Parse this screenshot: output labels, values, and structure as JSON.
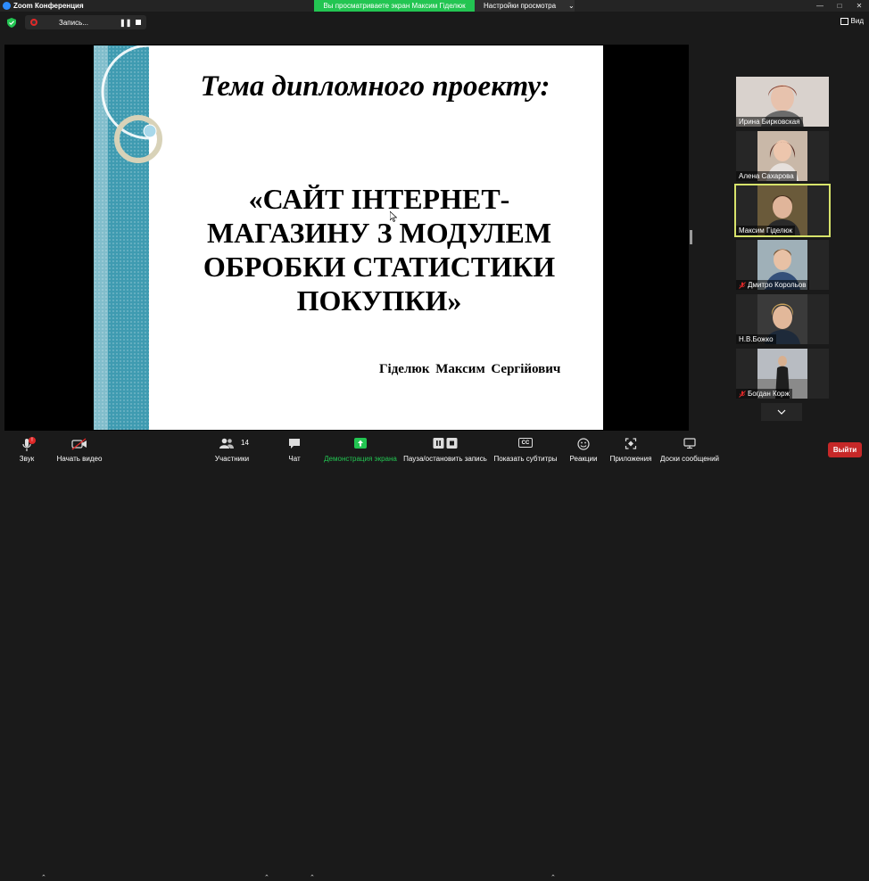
{
  "window": {
    "app_title": "Zoom Конференция",
    "viewing_banner": "Вы просматриваете экран Максим Гіделюк",
    "view_settings": "Настройки просмотра"
  },
  "recording": {
    "label": "Запись..."
  },
  "view_button": "Вид",
  "slide": {
    "title": "Тема дипломного проекту:",
    "topic_lines": [
      "«САЙТ ІНТЕРНЕТ-",
      "МАГАЗИНУ З МОДУЛЕМ",
      "ОБРОБКИ СТАТИСТИКИ",
      "ПОКУПКИ»"
    ],
    "author": "Гіделюк  Максим Сергійович"
  },
  "participants": [
    {
      "name": "Ирина Бирковская",
      "muted": false,
      "active": false
    },
    {
      "name": "Алена Сахарова",
      "muted": false,
      "active": false
    },
    {
      "name": "Максим Гіделюк",
      "muted": false,
      "active": true
    },
    {
      "name": "Дмитро Корольов",
      "muted": true,
      "active": false
    },
    {
      "name": "Н.В.Божко",
      "muted": false,
      "active": false
    },
    {
      "name": "Богдан Корж",
      "muted": true,
      "active": false
    }
  ],
  "toolbar": {
    "audio": "Звук",
    "audio_badge": "!",
    "video": "Начать видео",
    "participants": "Участники",
    "participants_count": "14",
    "chat": "Чат",
    "share": "Демонстрация экрана",
    "record": "Пауза/остановить запись",
    "captions": "Показать субтитры",
    "captions_icon": "CC",
    "reactions": "Реакции",
    "apps": "Приложения",
    "whiteboards": "Доски сообщений",
    "leave": "Выйти"
  },
  "colors": {
    "share_green": "#23c552",
    "leave_red": "#c62828",
    "active_border": "#d7e36b",
    "slide_band": "#3f9bb1"
  }
}
